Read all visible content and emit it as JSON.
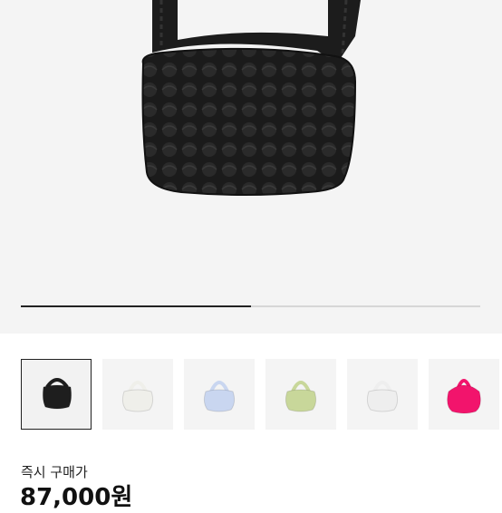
{
  "product": {
    "image_alt_icon": "quilted-bag-icon",
    "gallery_progress": 0.5,
    "thumbnails": [
      {
        "icon": "black-quilted-bag-icon",
        "color": "#1e1e1e",
        "selected": true
      },
      {
        "icon": "white-quilted-bag-icon",
        "color": "#efefea",
        "selected": false
      },
      {
        "icon": "light-blue-quilted-bag-icon",
        "color": "#c9d6f0",
        "selected": false
      },
      {
        "icon": "green-quilted-bag-icon",
        "color": "#c8d79a",
        "selected": false
      },
      {
        "icon": "white-quilted-bag-icon",
        "color": "#eeeeee",
        "selected": false
      },
      {
        "icon": "pink-quilted-bag-icon",
        "color": "#f2146c",
        "selected": false
      }
    ]
  },
  "purchase": {
    "label": "즉시 구매가",
    "price": "87,000원"
  }
}
